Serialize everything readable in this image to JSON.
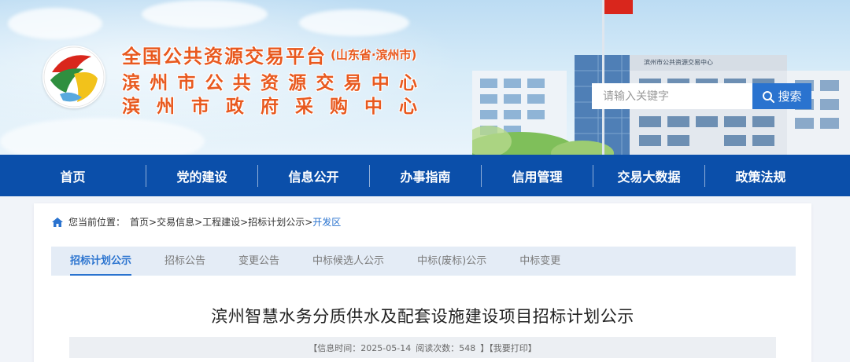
{
  "header": {
    "title_main": "全国公共资源交易平台",
    "title_region": "(山东省·滨州市)",
    "title_line2": "滨州市公共资源交易中心",
    "title_line3": "滨州市政府采购中心",
    "building_sign": "滨州市公共资源交易中心"
  },
  "search": {
    "placeholder": "请输入关键字",
    "button_label": "搜索"
  },
  "nav": {
    "items": [
      {
        "label": "首页"
      },
      {
        "label": "党的建设"
      },
      {
        "label": "信息公开"
      },
      {
        "label": "办事指南"
      },
      {
        "label": "信用管理"
      },
      {
        "label": "交易大数据"
      },
      {
        "label": "政策法规"
      }
    ]
  },
  "breadcrumb": {
    "prefix": "您当前位置：",
    "items": [
      "首页>",
      "交易信息>",
      "工程建设>",
      "招标计划公示>"
    ],
    "current": "开发区"
  },
  "tabs": [
    {
      "label": "招标计划公示",
      "active": true
    },
    {
      "label": "招标公告"
    },
    {
      "label": "变更公告"
    },
    {
      "label": "中标候选人公示"
    },
    {
      "label": "中标(废标)公示"
    },
    {
      "label": "中标变更"
    }
  ],
  "article": {
    "title": "滨州智慧水务分质供水及配套设施建设项目招标计划公示",
    "info_time": "【信息时间：2025-05-14",
    "read_count": "阅读次数：548",
    "print": "】【我要打印】"
  },
  "colors": {
    "nav_bg": "#0b4faa",
    "accent": "#2a73cf",
    "title_orange": "#e8591f",
    "flag_red": "#d9261c"
  },
  "icons": [
    "logo-emblem",
    "search-icon",
    "home-icon"
  ]
}
